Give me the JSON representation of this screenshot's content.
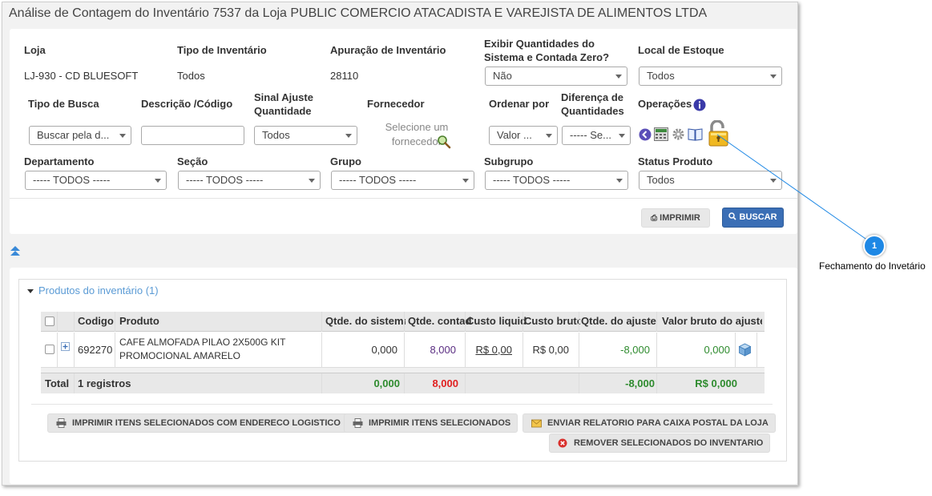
{
  "title": "Análise de Contagem do Inventário 7537 da Loja PUBLIC COMERCIO ATACADISTA E VAREJISTA DE ALIMENTOS LTDA",
  "filters": {
    "loja_label": "Loja",
    "loja_value": "LJ-930 - CD BLUESOFT",
    "tipo_inventario_label": "Tipo de Inventário",
    "tipo_inventario_value": "Todos",
    "apuracao_label": "Apuração de Inventário",
    "apuracao_value": "28110",
    "exibir_label": "Exibir Quantidades do Sistema e Contada Zero?",
    "exibir_value": "Não",
    "local_estoque_label": "Local de Estoque",
    "local_estoque_value": "Todos",
    "tipo_busca_label": "Tipo de Busca",
    "tipo_busca_value": "Buscar pela d...",
    "descricao_label": "Descrição /Código",
    "sinal_label": "Sinal Ajuste Quantidade",
    "sinal_value": "Todos",
    "fornecedor_label": "Fornecedor",
    "fornecedor_placeholder": "Selecione um fornecedor",
    "ordenar_label": "Ordenar por",
    "ordenar_value": "Valor ...",
    "diferenca_label": "Diferença de Quantidades",
    "diferenca_value": "----- Se...",
    "operacoes_label": "Operações",
    "departamento_label": "Departamento",
    "departamento_value": "----- TODOS -----",
    "secao_label": "Seção",
    "secao_value": "----- TODOS -----",
    "grupo_label": "Grupo",
    "grupo_value": "----- TODOS -----",
    "subgrupo_label": "Subgrupo",
    "subgrupo_value": "----- TODOS -----",
    "status_label": "Status Produto",
    "status_value": "Todos"
  },
  "actions": {
    "imprimir": "IMPRIMIR",
    "buscar": "BUSCAR"
  },
  "products": {
    "header": "Produtos do inventário (1)",
    "columns": [
      "Codigo",
      "Produto",
      "Qtde. do sistema",
      "Qtde. contada",
      "Custo liquido",
      "Custo bruto",
      "Qtde. do ajuste",
      "Valor bruto do ajuste"
    ],
    "rows": [
      {
        "codigo": "692270",
        "produto_line1": "CAFE ALMOFADA PILAO 2X500G KIT",
        "produto_line2": "PROMOCIONAL AMARELO",
        "qtde_sistema": "0,000",
        "qtde_contada": "8,000",
        "custo_liquido": "R$ 0,00",
        "custo_bruto": "R$ 0,00",
        "qtde_ajuste": "-8,000",
        "valor_bruto_ajuste": "0,000"
      }
    ],
    "footer": {
      "total_label": "Total",
      "registros": "1 registros",
      "qtde_sistema": "0,000",
      "qtde_contada": "8,000",
      "qtde_ajuste": "-8,000",
      "valor_bruto_ajuste": "R$ 0,000"
    }
  },
  "bottom_buttons": {
    "print_logistic": "IMPRIMIR ITENS SELECIONADOS COM ENDERECO LOGISTICO",
    "print_selected": "IMPRIMIR ITENS SELECIONADOS",
    "send_report": "ENVIAR RELATORIO PARA CAIXA POSTAL DA LOJA",
    "remove_selected": "REMOVER SELECIONADOS DO INVENTARIO"
  },
  "callout": {
    "number": "1",
    "text": "Fechamento do Invetário"
  },
  "colors": {
    "accent": "#3a6eb5",
    "positive": "#2e8b2e",
    "negative": "#e02020",
    "callout": "#1e88e5"
  },
  "icons": [
    "back-circle-icon",
    "calculator-icon",
    "gear-icon",
    "book-icon",
    "unlocked-padlock-icon",
    "info-icon",
    "search-magnifier-icon",
    "printer-icon",
    "search-icon",
    "double-chevron-up-icon",
    "expand-plus-icon",
    "cube-icon",
    "mail-icon",
    "remove-circle-icon"
  ]
}
